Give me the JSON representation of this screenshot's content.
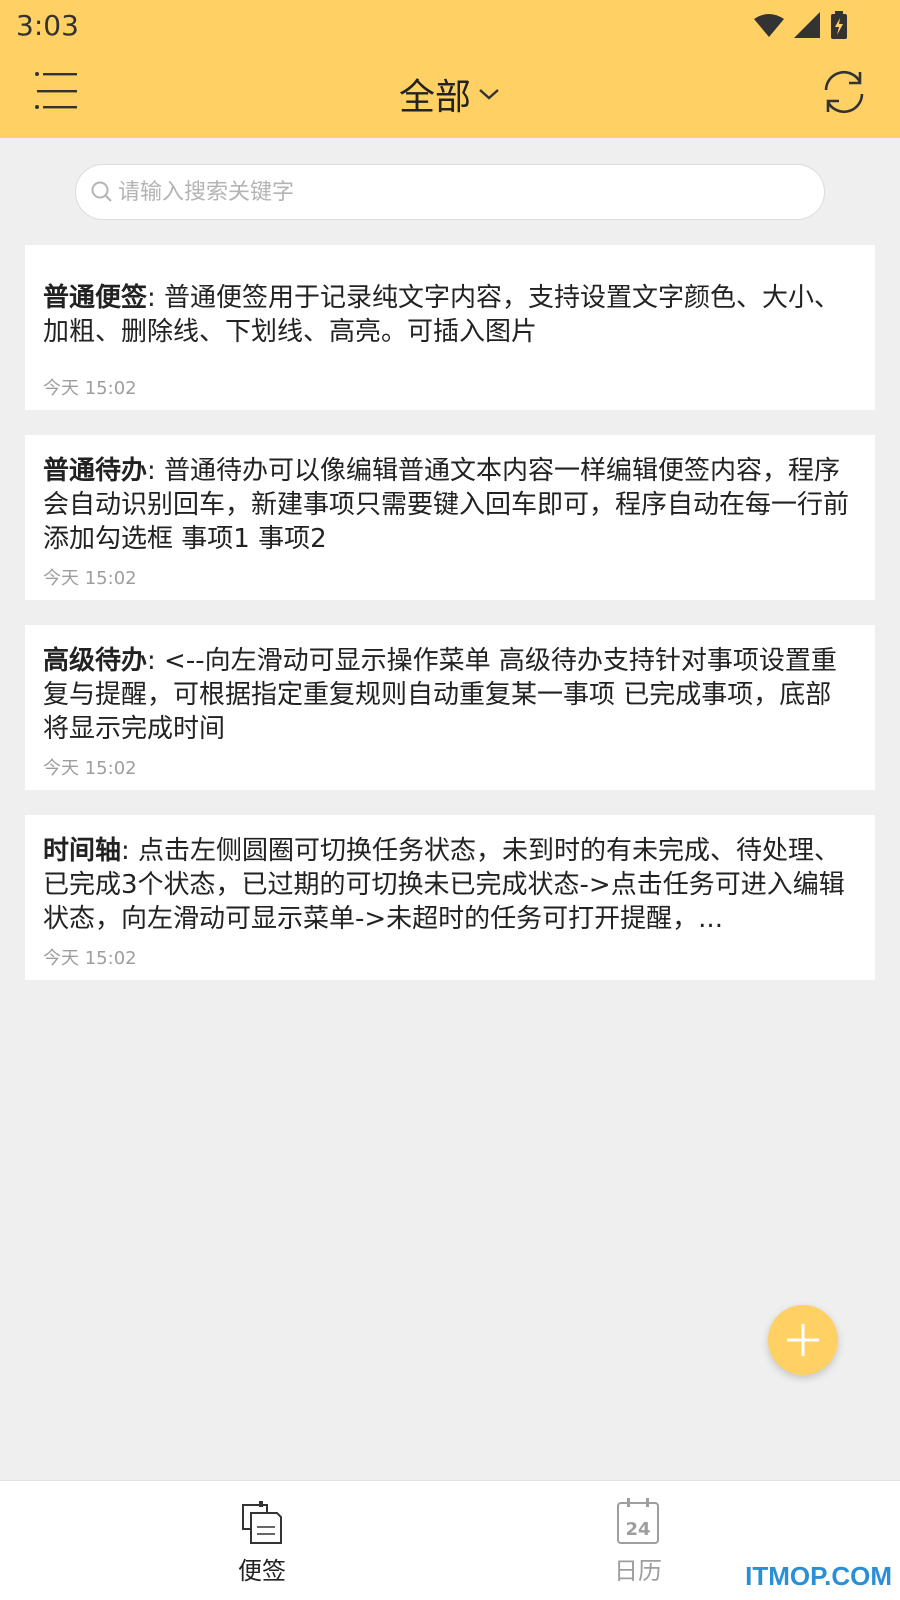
{
  "status_bar": {
    "time": "3:03"
  },
  "header": {
    "title": "全部"
  },
  "search": {
    "placeholder": "请输入搜索关键字"
  },
  "notes": [
    {
      "type": "普通便签",
      "sep": ": ",
      "body": "普通便签用于记录纯文字内容，支持设置文字颜色、大小、加粗、删除线、下划线、高亮。可插入图片",
      "time": "今天 15:02"
    },
    {
      "type": "普通待办",
      "sep": ": ",
      "body": "普通待办可以像编辑普通文本内容一样编辑便签内容，程序会自动识别回车，新建事项只需要键入回车即可，程序自动在每一行前添加勾选框 事项1 事项2",
      "time": "今天 15:02"
    },
    {
      "type": "高级待办",
      "sep": ": ",
      "body": "<--向左滑动可显示操作菜单 高级待办支持针对事项设置重复与提醒，可根据指定重复规则自动重复某一事项 已完成事项，底部将显示完成时间",
      "time": "今天 15:02"
    },
    {
      "type": "时间轴",
      "sep": ": ",
      "body": "点击左侧圆圈可切换任务状态，未到时的有未完成、待处理、已完成3个状态，已过期的可切换未已完成状态->点击任务可进入编辑状态，向左滑动可显示菜单->未超时的任务可打开提醒，...",
      "time": "今天 15:02"
    }
  ],
  "bottom_nav": {
    "items": [
      {
        "label": "便签",
        "active": true
      },
      {
        "label": "日历",
        "active": false,
        "calendar_day": "24"
      }
    ]
  },
  "watermark": "ITMOP.COM",
  "colors": {
    "accent": "#ffd064",
    "background": "#efefef",
    "text": "#222222",
    "muted": "#9e9e9e"
  }
}
